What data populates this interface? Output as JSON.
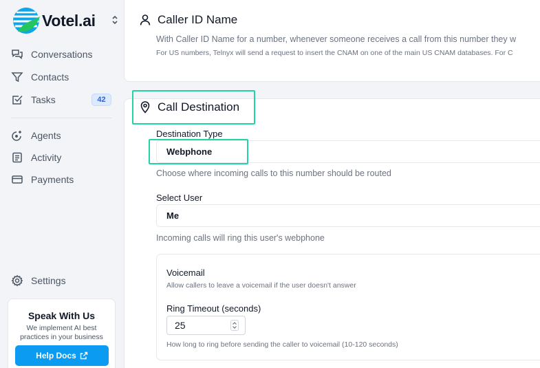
{
  "brand": {
    "name": "Votel.ai",
    "logo_icon": "globe-logo-icon",
    "switch_icon": "chevrons-up-down-icon"
  },
  "sidebar": {
    "items": [
      {
        "label": "Conversations",
        "icon": "chat-bubbles-icon"
      },
      {
        "label": "Contacts",
        "icon": "funnel-icon"
      },
      {
        "label": "Tasks",
        "icon": "checkbox-icon",
        "badge": "42"
      },
      {
        "label": "Agents",
        "icon": "agent-spark-icon"
      },
      {
        "label": "Activity",
        "icon": "list-document-icon"
      },
      {
        "label": "Payments",
        "icon": "credit-card-icon"
      }
    ],
    "settings": {
      "label": "Settings",
      "icon": "gear-icon"
    },
    "promo": {
      "title": "Speak With Us",
      "text": "We implement AI best practices in your business",
      "button": "Help Docs",
      "button_icon": "external-link-icon"
    }
  },
  "caller_id": {
    "title": "Caller ID Name",
    "icon": "user-icon",
    "description": "With Caller ID Name for a number, whenever someone receives a call from this number they w",
    "note": "For US numbers, Telnyx will send a request to insert the CNAM on one of the main US CNAM databases. For C"
  },
  "call_destination": {
    "title": "Call Destination",
    "icon": "map-pin-icon",
    "destination_type": {
      "label": "Destination Type",
      "value": "Webphone",
      "help": "Choose where incoming calls to this number should be routed"
    },
    "select_user": {
      "label": "Select User",
      "value": "Me",
      "help": "Incoming calls will ring this user's webphone"
    },
    "voicemail": {
      "title": "Voicemail",
      "description": "Allow callers to leave a voicemail if the user doesn't answer",
      "ring_timeout_label": "Ring Timeout (seconds)",
      "ring_timeout_value": "25",
      "ring_timeout_help": "How long to ring before sending the caller to voicemail (10-120 seconds)"
    }
  },
  "colors": {
    "accent": "#0b9bf0",
    "highlight": "#22d3a6",
    "badge_bg": "#dbeafe",
    "badge_text": "#2563eb"
  }
}
